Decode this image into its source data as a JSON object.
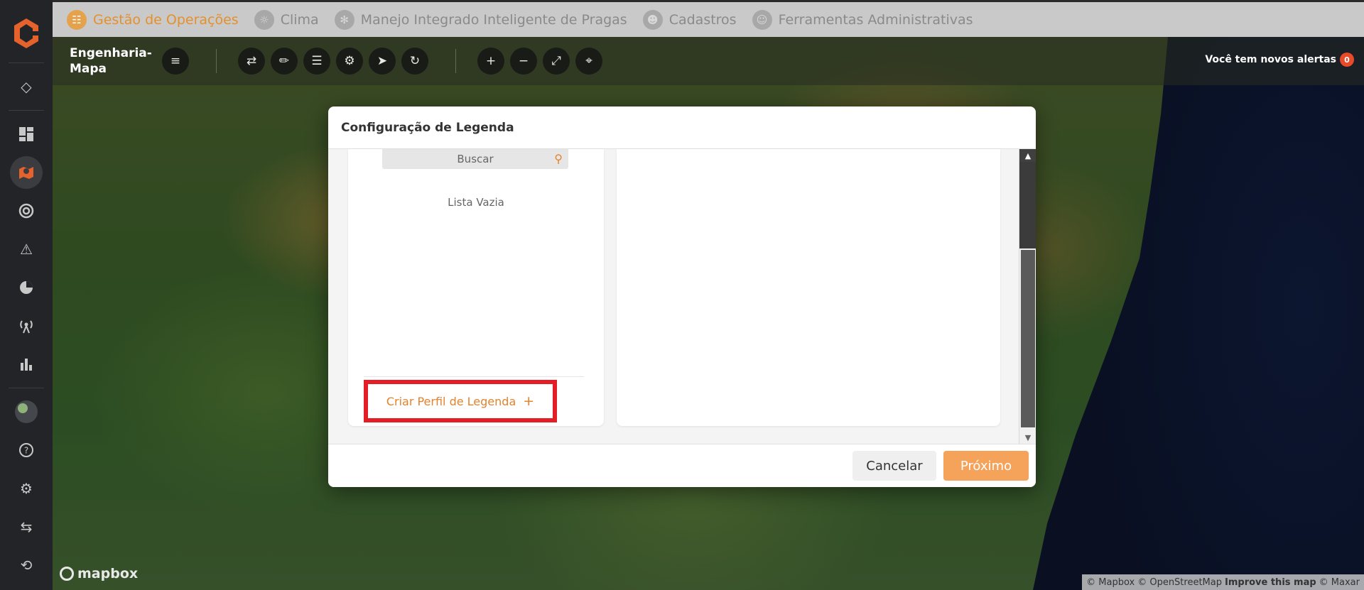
{
  "topnav": {
    "items": [
      {
        "label": "Gestão de Operações",
        "icon": "operations-icon",
        "active": true
      },
      {
        "label": "Clima",
        "icon": "sun-icon"
      },
      {
        "label": "Manejo Integrado Inteligente de Pragas",
        "icon": "pest-icon"
      },
      {
        "label": "Cadastros",
        "icon": "user-icon"
      },
      {
        "label": "Ferramentas Administrativas",
        "icon": "admin-user-icon"
      }
    ]
  },
  "toolbar": {
    "title": "Engenharia-\nMapa",
    "alerts_label": "Você tem novos alertas",
    "alerts_count": "0"
  },
  "modal": {
    "title": "Configuração de Legenda",
    "search_placeholder": "Buscar",
    "empty_label": "Lista Vazia",
    "create_label": "Criar Perfil de Legenda",
    "create_plus": "+",
    "cancel_label": "Cancelar",
    "next_label": "Próximo"
  },
  "map": {
    "logo_text": "mapbox",
    "attribution": {
      "mapbox": "© Mapbox",
      "osm": "© OpenStreetMap",
      "improve": "Improve this map",
      "maxar": "© Maxar"
    }
  },
  "colors": {
    "accent": "#e5822c",
    "highlight": "#e41e26",
    "next_button": "#f5a25a"
  }
}
